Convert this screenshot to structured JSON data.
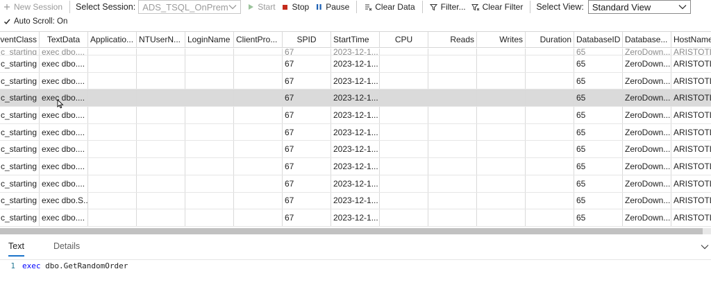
{
  "toolbar": {
    "new_session": "New Session",
    "select_session_label": "Select Session:",
    "session_value": "ADS_TSQL_OnPrem",
    "start": "Start",
    "stop": "Stop",
    "pause": "Pause",
    "clear_data": "Clear Data",
    "filter": "Filter...",
    "clear_filter": "Clear Filter",
    "select_view_label": "Select View:",
    "view_value": "Standard View",
    "auto_scroll": "Auto Scroll: On"
  },
  "colors": {
    "accent": "#1a73c9",
    "stop_red": "#c42b1c",
    "start_green": "#9bc39b",
    "pause_blue": "#1a5fb4",
    "keyword": "#0000ff"
  },
  "grid": {
    "columns": [
      "ventClass",
      "TextData",
      "Applicatio...",
      "NTUserN...",
      "LoginName",
      "ClientPro...",
      "SPID",
      "StartTime",
      "CPU",
      "Reads",
      "Writes",
      "Duration",
      "DatabaseID",
      "Database...",
      "HostName"
    ],
    "partial_row": [
      "c_starting",
      "exec dbo....",
      "",
      "",
      "",
      "",
      "67",
      "2023-12-1...",
      "",
      "",
      "",
      "",
      "65",
      "ZeroDown...",
      "ARISTOTLE"
    ],
    "rows": [
      [
        "c_starting",
        "exec dbo....",
        "",
        "",
        "",
        "",
        "67",
        "2023-12-1...",
        "",
        "",
        "",
        "",
        "65",
        "ZeroDown...",
        "ARISTOTLE"
      ],
      [
        "c_starting",
        "exec dbo....",
        "",
        "",
        "",
        "",
        "67",
        "2023-12-1...",
        "",
        "",
        "",
        "",
        "65",
        "ZeroDown...",
        "ARISTOTLE"
      ],
      [
        "c_starting",
        "exec dbo....",
        "",
        "",
        "",
        "",
        "67",
        "2023-12-1...",
        "",
        "",
        "",
        "",
        "65",
        "ZeroDown...",
        "ARISTOTLE"
      ],
      [
        "c_starting",
        "exec dbo....",
        "",
        "",
        "",
        "",
        "67",
        "2023-12-1...",
        "",
        "",
        "",
        "",
        "65",
        "ZeroDown...",
        "ARISTOTLE"
      ],
      [
        "c_starting",
        "exec dbo....",
        "",
        "",
        "",
        "",
        "67",
        "2023-12-1...",
        "",
        "",
        "",
        "",
        "65",
        "ZeroDown...",
        "ARISTOTLE"
      ],
      [
        "c_starting",
        "exec dbo....",
        "",
        "",
        "",
        "",
        "67",
        "2023-12-1...",
        "",
        "",
        "",
        "",
        "65",
        "ZeroDown...",
        "ARISTOTLE"
      ],
      [
        "c_starting",
        "exec dbo....",
        "",
        "",
        "",
        "",
        "67",
        "2023-12-1...",
        "",
        "",
        "",
        "",
        "65",
        "ZeroDown...",
        "ARISTOTLE"
      ],
      [
        "c_starting",
        "exec dbo....",
        "",
        "",
        "",
        "",
        "67",
        "2023-12-1...",
        "",
        "",
        "",
        "",
        "65",
        "ZeroDown...",
        "ARISTOTLE"
      ],
      [
        "c_starting",
        "exec dbo.S...",
        "",
        "",
        "",
        "",
        "67",
        "2023-12-1...",
        "",
        "",
        "",
        "",
        "65",
        "ZeroDown...",
        "ARISTOTLE"
      ],
      [
        "c_starting",
        "exec dbo....",
        "",
        "",
        "",
        "",
        "67",
        "2023-12-1...",
        "",
        "",
        "",
        "",
        "65",
        "ZeroDown...",
        "ARISTOTLE"
      ]
    ],
    "selected_row_index": 2
  },
  "panel": {
    "tabs": [
      "Text",
      "Details"
    ],
    "active_tab": "Text",
    "code_line_number": "1",
    "code_keyword": "exec",
    "code_text": "dbo.GetRandomOrder"
  }
}
